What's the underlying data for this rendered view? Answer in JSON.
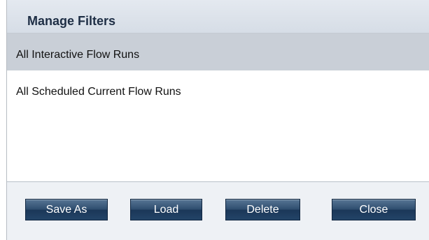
{
  "dialog": {
    "title": "Manage Filters"
  },
  "filters": {
    "items": [
      {
        "label": "All Interactive Flow Runs",
        "selected": true
      },
      {
        "label": "All Scheduled Current Flow Runs",
        "selected": false
      }
    ]
  },
  "buttons": {
    "save_as_label": "Save As",
    "load_label": "Load",
    "delete_label": "Delete",
    "close_label": "Close"
  },
  "colors": {
    "header_bg": "#dde3eb",
    "selected_row_bg": "#c9cfd7",
    "button_bg": "#2f4e6f",
    "button_text": "#ffffff"
  }
}
